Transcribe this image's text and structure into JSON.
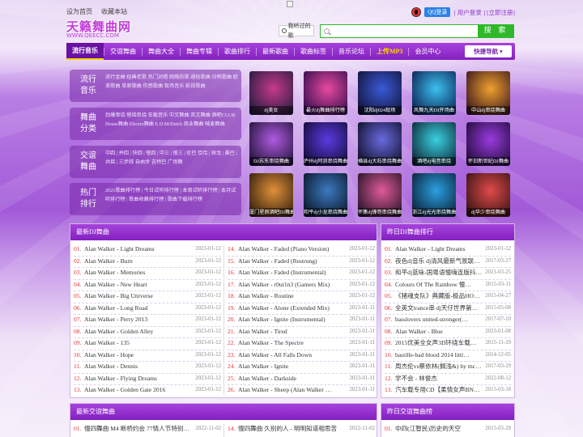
{
  "top": {
    "links": [
      "设为首页",
      "收藏本站"
    ],
    "qq_login": "QQ登录",
    "user_links": "[ 用户登录 ] [立即注册]"
  },
  "header": {
    "logo_text": "天籁舞曲网",
    "logo_url": "WWW.QEECC.COM",
    "history_label": "我听过的歌",
    "search_placeholder": "",
    "search_button": "搜 索"
  },
  "nav": {
    "items": [
      "流行音乐",
      "交谊舞曲",
      "舞曲大全",
      "舞曲专辑",
      "歌曲排行",
      "最新歌曲",
      "歌曲标签",
      "音乐论坛",
      "上传MP3",
      "会员中心"
    ],
    "quick_nav": "快捷导航 ▾"
  },
  "categories": [
    {
      "title": "流行\n音乐",
      "links": "流行金曲 经典老歌 热门对唱 网络热歌 通俗歌曲 日韩歌曲 欧美歌曲 草原歌曲 伤感歌曲 现场音乐 影视歌曲"
    },
    {
      "title": "舞曲\n分类",
      "links": "劲爆串烧 慢摇串烧 车载音乐 中文舞曲 英文舞曲 酒吧CLUB House舞曲 Electro舞曲 E.D.M/Dutch 商业舞曲 喊麦舞曲"
    },
    {
      "title": "交谊\n舞曲",
      "links": "中四 | 并四 | 快四 | 慢四 | 中三 | 慢三 | 伦巴 恰恰 | 探戈 | 桑巴 | 井摇 | 三步踩 自由步 吉特巴 广场舞"
    },
    {
      "title": "热门\n排行",
      "links": "2021歌曲排行榜 | 今日试听排行榜 | 本周试听排行榜 | 本月试听排行榜 | 歌曲收藏排行榜 | 歌曲下载排行榜"
    }
  ],
  "thumbs": [
    {
      "caption": "dj美女",
      "c1": "#1a1a3a",
      "c2": "#c83a8a"
    },
    {
      "caption": "最火dj舞曲排行榜",
      "c1": "#2a0a4a",
      "c2": "#e84aa0"
    },
    {
      "caption": "沈阳dj024现场",
      "c1": "#101030",
      "c2": "#3a5ad8"
    },
    {
      "caption": "风舞九天DJ开场曲",
      "c1": "#0a1a4a",
      "c2": "#3ac0f0"
    },
    {
      "caption": "中山dj串烧舞曲",
      "c1": "#30101a",
      "c2": "#f0a030"
    },
    {
      "caption": "DJ苏东串烧舞曲",
      "c1": "#1a1030",
      "c2": "#b05ae0"
    },
    {
      "caption": "庐州dj阿浪串烧舞曲",
      "c1": "#100a30",
      "c2": "#5a3ae0"
    },
    {
      "caption": "横县dj大石串烧舞曲",
      "c1": "#0a0a20",
      "c2": "#6a6ae0"
    },
    {
      "caption": "酒吧dj电音串烧",
      "c1": "#0a2030",
      "c2": "#3ad0e0"
    },
    {
      "caption": "怀旧新世纪DJ舞曲",
      "c1": "#1a0a30",
      "c2": "#9a3ae0"
    },
    {
      "caption": "厦门星辰酒吧DJ舞曲",
      "c1": "#2a1a0a",
      "c2": "#e0903a"
    },
    {
      "caption": "和平dj小龙串烧舞曲",
      "c1": "#0a1020",
      "c2": "#3a7ac0"
    },
    {
      "caption": "怀集dj锋哥串烧舞曲",
      "c1": "#1a1020",
      "c2": "#e05a9a"
    },
    {
      "caption": "浙江dj光光串烧舞曲",
      "c1": "#0a1a30",
      "c2": "#2aa0e0"
    },
    {
      "caption": "dj华少串烧舞曲",
      "c1": "#301010",
      "c2": "#e04a4a"
    }
  ],
  "panels": {
    "latest_dj": {
      "title": "最新DJ舞曲",
      "left": [
        {
          "num": "01.",
          "title": "Alan Walker - Light Dreams",
          "date": "2023-01-12"
        },
        {
          "num": "02.",
          "title": "Alan Walker - Burn",
          "date": "2023-01-12"
        },
        {
          "num": "03.",
          "title": "Alan Walker - Memories",
          "date": "2023-01-12"
        },
        {
          "num": "04.",
          "title": "Alan Walker - New Heart",
          "date": "2023-01-12"
        },
        {
          "num": "05.",
          "title": "Alan Walker - Big Universe",
          "date": "2023-01-12"
        },
        {
          "num": "06.",
          "title": "Alan Walker - Long Road",
          "date": "2023-01-12"
        },
        {
          "num": "07.",
          "title": "Alan Walker - Perry 2013",
          "date": "2023-01-12"
        },
        {
          "num": "08.",
          "title": "Alan Walker - Golden Alley",
          "date": "2023-01-12"
        },
        {
          "num": "09.",
          "title": "Alan Walker - 135",
          "date": "2023-01-12"
        },
        {
          "num": "10.",
          "title": "Alan Walker - Hope",
          "date": "2023-01-12"
        },
        {
          "num": "11.",
          "title": "Alan Walker - Dennis",
          "date": "2023-01-12"
        },
        {
          "num": "12.",
          "title": "Alan Walker - Flying Dreams",
          "date": "2023-01-12"
        },
        {
          "num": "13.",
          "title": "Alan Walker - Golden Gate 2016",
          "date": "2023-01-12"
        }
      ],
      "right": [
        {
          "num": "14.",
          "title": "Alan Walker - Faded (Piano Version)",
          "date": "2023-01-12"
        },
        {
          "num": "15.",
          "title": "Alan Walker - Faded (Restrung)",
          "date": "2023-01-12"
        },
        {
          "num": "16.",
          "title": "Alan Walker - Faded (Instrumental)",
          "date": "2023-01-12"
        },
        {
          "num": "17.",
          "title": "Alan Walker - r0ut1n3 (Gamers Mix)",
          "date": "2023-01-12"
        },
        {
          "num": "18.",
          "title": "Alan Walker - Routine",
          "date": "2023-01-12"
        },
        {
          "num": "19.",
          "title": "Alan Walker - Alone (Extended Mix)",
          "date": "2023-01-11"
        },
        {
          "num": "20.",
          "title": "Alan Walker - Ignite (Instrumental)",
          "date": "2023-01-11"
        },
        {
          "num": "21.",
          "title": "Alan Walker - Tired",
          "date": "2023-01-11"
        },
        {
          "num": "22.",
          "title": "Alan Walker - The Spectre",
          "date": "2023-01-11"
        },
        {
          "num": "23.",
          "title": "Alan Walker - All Falls Down",
          "date": "2023-01-11"
        },
        {
          "num": "24.",
          "title": "Alan Walker - Ignite",
          "date": "2023-01-11"
        },
        {
          "num": "25.",
          "title": "Alan Walker - Darkside",
          "date": "2023-01-11"
        },
        {
          "num": "26.",
          "title": "Alan Walker - Sheep (Alan Walker …",
          "date": "2023-01-11"
        }
      ]
    },
    "yesterday_dj": {
      "title": "昨日DJ舞曲排行",
      "rows": [
        {
          "num": "01.",
          "title": "Alan Walker - Light Dreams",
          "date": "2023-01-12"
        },
        {
          "num": "02.",
          "title": "夜色dj音乐 dj清风最新气氛联…",
          "date": "2017-03-27"
        },
        {
          "num": "03.",
          "title": "和平dj蓝咏-国粤语慢嗨连版抖…",
          "date": "2021-03-25"
        },
        {
          "num": "04.",
          "title": "Colours Of The Rainbow 慢…",
          "date": "2015-03-11"
        },
        {
          "num": "05.",
          "title": "《猪魂支队》典藏版-极品HO…",
          "date": "2015-04-27"
        },
        {
          "num": "06.",
          "title": "全英文trance串 dj天仔世界第…",
          "date": "2015-05-08"
        },
        {
          "num": "07.",
          "title": "basslovers united-stronger(…",
          "date": "2017-07-10"
        },
        {
          "num": "08.",
          "title": "Alan Walker - Blue",
          "date": "2023-01-08"
        },
        {
          "num": "09.",
          "title": "2015优美全女声3D环绕车载…",
          "date": "2015-11-20"
        },
        {
          "num": "10.",
          "title": "bastille-bad blood 2014 littl…",
          "date": "2014-12-05"
        },
        {
          "num": "11.",
          "title": "周杰伦vs蔡依林(搁浅&) by mc…",
          "date": "2017-03-29"
        },
        {
          "num": "12.",
          "title": "学不会 - 林俊杰",
          "date": "2022-08-12"
        },
        {
          "num": "13.",
          "title": "汽车载专用CD【柔情女声BN…",
          "date": "2015-03-18"
        }
      ]
    },
    "latest_ballroom": {
      "title": "最新交谊舞曲",
      "left": [
        {
          "num": "01.",
          "title": "慢四舞曲 M4 断桥约会 77情人节特别…",
          "date": "2022-11-02"
        }
      ],
      "right": [
        {
          "num": "14.",
          "title": "慢四舞曲 久别的人 - 明明知道相思苦",
          "date": "2022-11-02"
        }
      ]
    },
    "yesterday_ballroom": {
      "title": "昨日交谊舞曲榜",
      "rows": [
        {
          "num": "01.",
          "title": "中四(江智民)历史的天空",
          "date": "2015-03-28"
        }
      ]
    }
  },
  "colors": {
    "accent": "#8a28c6",
    "search": "#2fb82a",
    "number": "#e53232"
  }
}
